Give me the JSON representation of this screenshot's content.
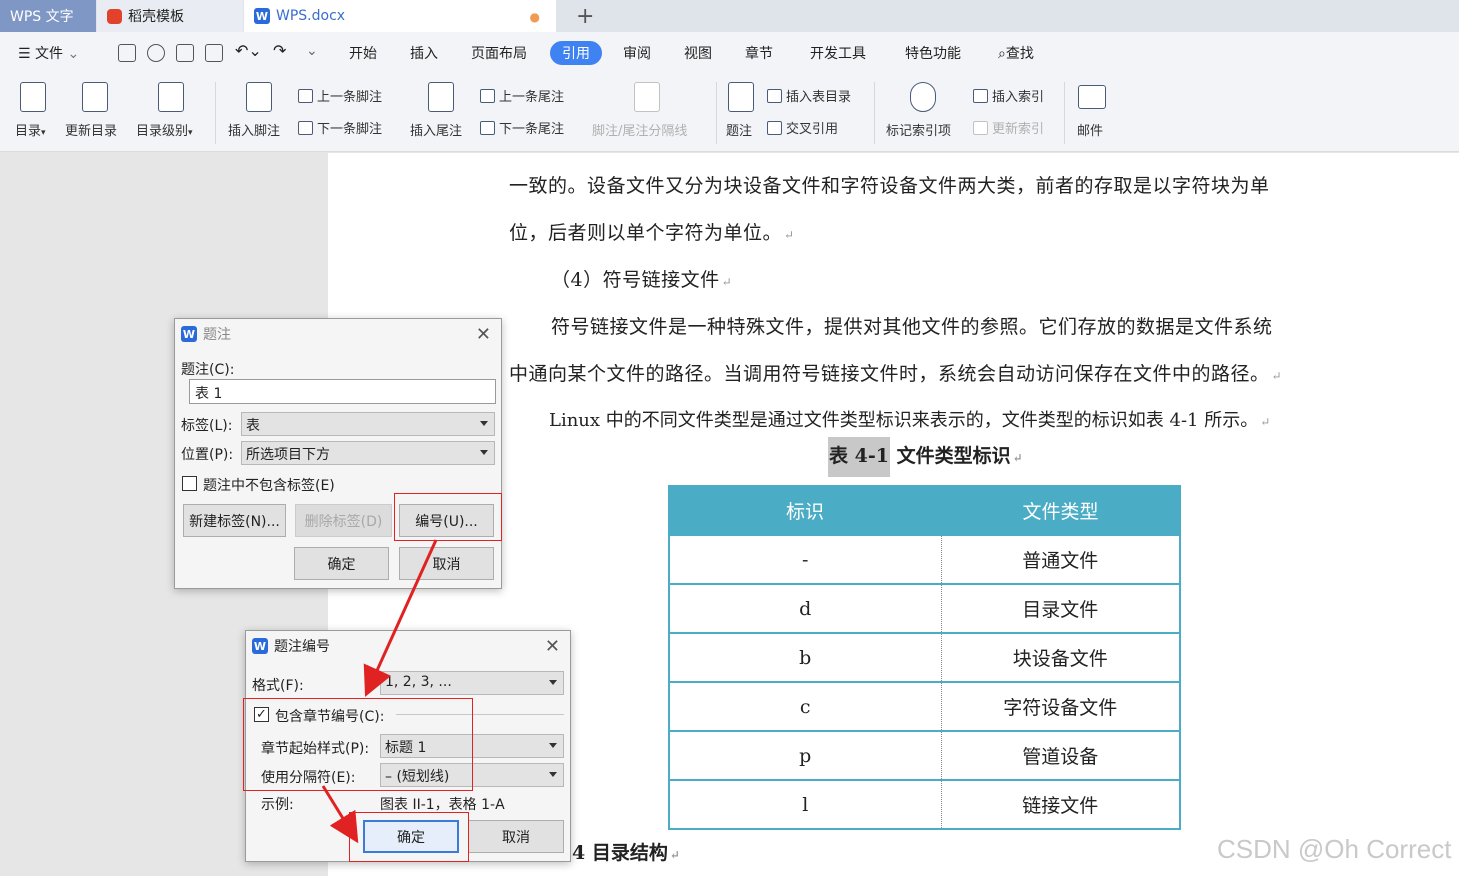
{
  "tabs": {
    "wps": "WPS 文字",
    "daoke": "稻壳模板",
    "doc": "WPS.docx",
    "add": "+"
  },
  "menubar": {
    "file": "文件",
    "items": [
      "开始",
      "插入",
      "页面布局",
      "引用",
      "审阅",
      "视图",
      "章节",
      "开发工具",
      "特色功能"
    ],
    "search": "查找",
    "active_index": 3
  },
  "ribbon": {
    "toc": "目录",
    "update_toc": "更新目录",
    "toc_level": "目录级别",
    "insert_footnote": "插入脚注",
    "prev_footnote": "上一条脚注",
    "next_footnote": "下一条脚注",
    "insert_endnote": "插入尾注",
    "prev_endnote": "上一条尾注",
    "next_endnote": "下一条尾注",
    "note_separator": "脚注/尾注分隔线",
    "caption": "题注",
    "insert_toc_table": "插入表目录",
    "cross_ref": "交叉引用",
    "mark_index": "标记索引项",
    "insert_index": "插入索引",
    "update_index": "更新索引",
    "mail": "邮件"
  },
  "document": {
    "p1": "一致的。设备文件又分为块设备文件和字符设备文件两大类，前者的存取是以字符块为单",
    "p2": "位，后者则以单个字符为单位。",
    "p3": "（4）符号链接文件",
    "p4": "符号链接文件是一种特殊文件，提供对其他文件的参照。它们存放的数据是文件系统",
    "p5": "中通向某个文件的路径。当调用符号链接文件时，系统会自动访问保存在文件中的路径。",
    "p6": "Linux 中的不同文件类型是通过文件类型标识来表示的，文件类型的标识如表 4-1 所示。",
    "caption_num": "表 4-1",
    "caption_text": "文件类型标识",
    "table": {
      "headers": [
        "标识",
        "文件类型"
      ],
      "rows": [
        [
          "-",
          "普通文件"
        ],
        [
          "d",
          "目录文件"
        ],
        [
          "b",
          "块设备文件"
        ],
        [
          "c",
          "字符设备文件"
        ],
        [
          "p",
          "管道设备"
        ],
        [
          "l",
          "链接文件"
        ]
      ]
    },
    "heading4": "4 目录结构",
    "watermark": "CSDN @Oh Correct"
  },
  "caption_dialog": {
    "title": "题注",
    "caption_label": "题注(C):",
    "caption_value": "表 1",
    "label_label": "标签(L):",
    "label_value": "表",
    "position_label": "位置(P):",
    "position_value": "所选项目下方",
    "exclude_label": "题注中不包含标签(E)",
    "new_label": "新建标签(N)...",
    "delete_label": "删除标签(D)",
    "numbering": "编号(U)...",
    "ok": "确定",
    "cancel": "取消"
  },
  "numbering_dialog": {
    "title": "题注编号",
    "format_label": "格式(F):",
    "format_value": "1, 2, 3, ...",
    "include_chapter": "包含章节编号(C):",
    "chapter_style_label": "章节起始样式(P):",
    "chapter_style_value": "标题 1",
    "separator_label": "使用分隔符(E):",
    "separator_value": "– (短划线)",
    "example_label": "示例:",
    "example_value": "图表 II-1，表格 1-A",
    "ok": "确定",
    "cancel": "取消"
  },
  "colors": {
    "accent": "#3f82f2",
    "table_header": "#4bacc6",
    "annotation": "#e02222"
  }
}
